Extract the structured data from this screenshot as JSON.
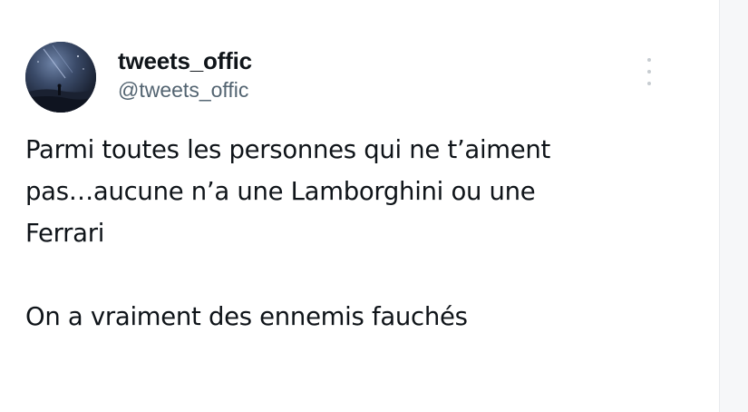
{
  "tweet": {
    "author": {
      "display_name": "tweets_offic",
      "handle": "@tweets_offic",
      "avatar_icon": "night-scene-avatar"
    },
    "menu_icon": "more-vertical-icon",
    "text": {
      "line1": "Parmi toutes les personnes qui ne t’aiment",
      "line2": "pas…aucune n’a une Lamborghini ou une",
      "line3": "Ferrari",
      "line4": "On a vraiment des ennemis fauchés"
    }
  },
  "colors": {
    "text_primary": "#0f1419",
    "text_secondary": "#536471",
    "panel_bg": "#f6f7f9"
  }
}
